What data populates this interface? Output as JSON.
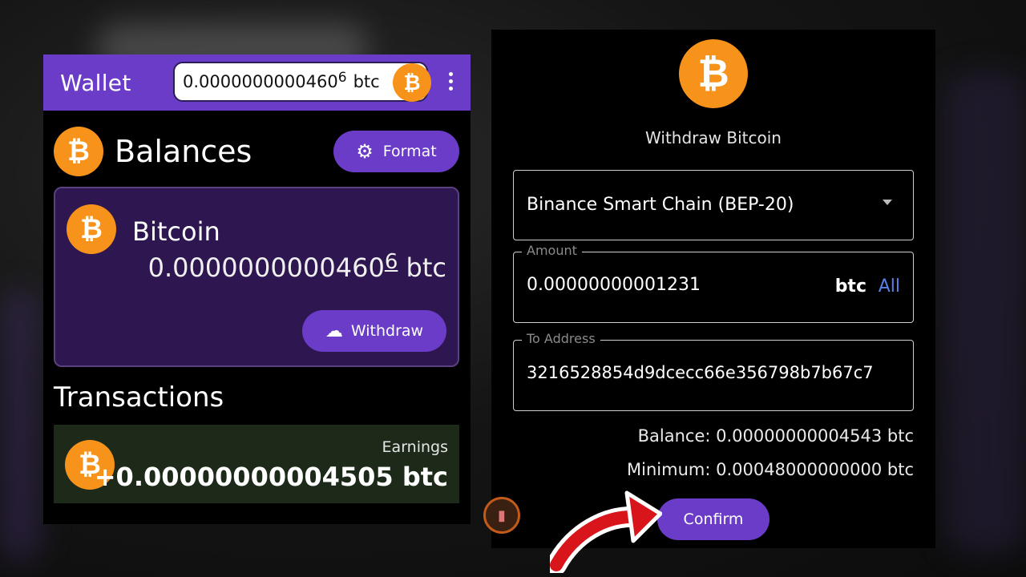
{
  "wallet": {
    "title": "Wallet",
    "header_balance_main": "0.0000000000460",
    "header_balance_sup": "6",
    "header_unit": "btc",
    "coin_symbol": "₿",
    "menu_icon": "kebab-menu-icon",
    "balances_title": "Balances",
    "format_label": "Format",
    "card": {
      "name": "Bitcoin",
      "amount_main": "0.0000000000460",
      "amount_sup": "6",
      "unit": "btc",
      "withdraw_label": "Withdraw"
    },
    "transactions_title": "Transactions",
    "transactions": [
      {
        "kind": "Earnings",
        "amount": "+0.00000000004505 btc"
      }
    ]
  },
  "withdraw": {
    "title": "Withdraw Bitcoin",
    "chain": "Binance Smart Chain (BEP-20)",
    "amount_label": "Amount",
    "amount_value": "0.00000000001231",
    "amount_unit": "btc",
    "all_label": "All",
    "address_label": "To Address",
    "address_value": "3216528854d9dcecc66e356798b7b67c7",
    "balance_text": "Balance: 0.00000000004543 btc",
    "minimum_text": "Minimum: 0.00048000000000 btc",
    "confirm_label": "Confirm"
  },
  "colors": {
    "accent": "#6a3cc7",
    "bitcoin": "#f7931a",
    "card_bg": "#2e1650",
    "tx_bg": "#1d2a1a",
    "link": "#5b7fe8"
  }
}
